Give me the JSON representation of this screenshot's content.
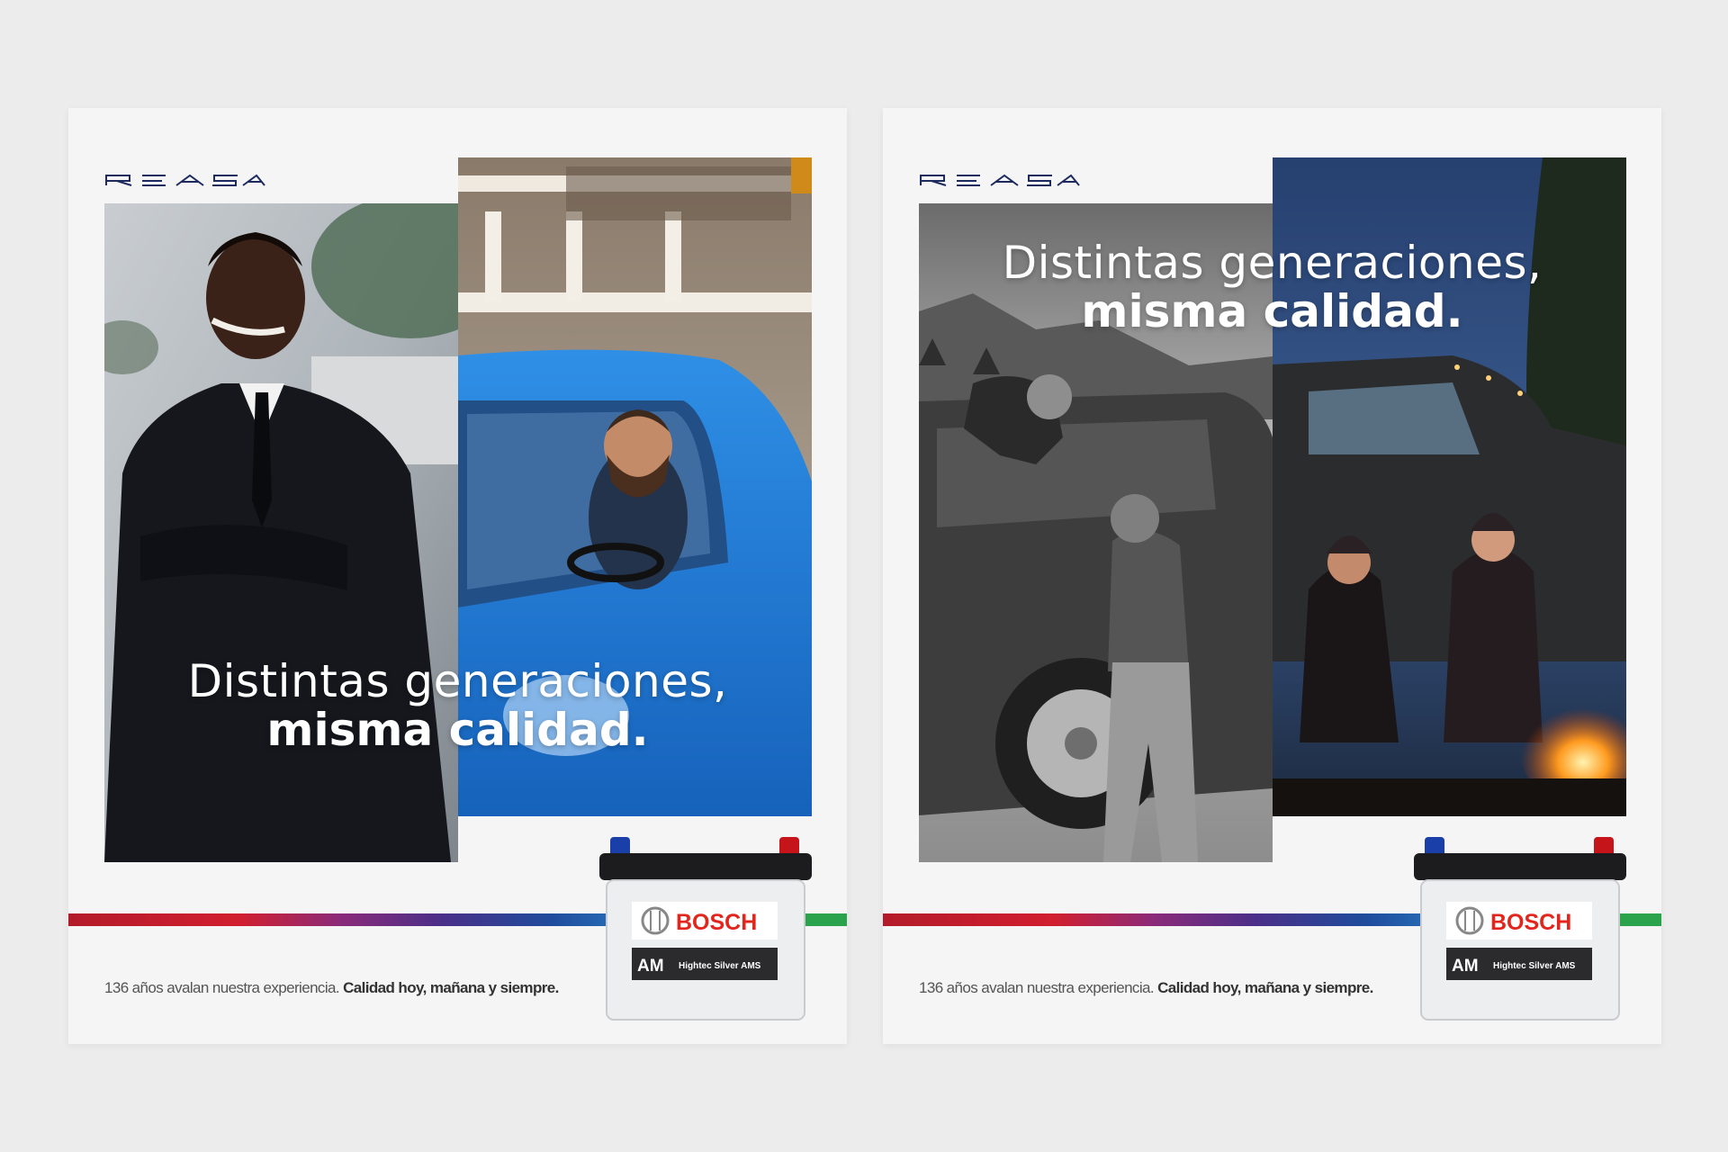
{
  "ads": [
    {
      "brand": "REASA",
      "headline_line1": "Distintas generaciones,",
      "headline_line2": "misma calidad.",
      "tagline_regular": "136 años avalan nuestra experiencia.",
      "tagline_bold": "Calidad hoy, mañana y siempre.",
      "battery": {
        "brand": "BOSCH",
        "code": "AM",
        "model": "Hightec Silver AMS"
      },
      "photos": [
        "smiling man in black suit with crossed arms",
        "bearded man driving blue car"
      ]
    },
    {
      "brand": "REASA",
      "headline_line1": "Distintas generaciones,",
      "headline_line2": "misma calidad.",
      "tagline_regular": "136 años avalan nuestra experiencia.",
      "tagline_bold": "Calidad hoy, mañana y siempre.",
      "battery": {
        "brand": "BOSCH",
        "code": "AM",
        "model": "Hightec Silver AMS"
      },
      "photos": [
        "two boys climbing a pickup truck in black and white",
        "two women by a campfire beside a truck at dusk"
      ]
    }
  ],
  "colors": {
    "background": "#ececec",
    "card": "#f5f5f5",
    "bosch_red": "#e2261d",
    "text": "#555555"
  }
}
